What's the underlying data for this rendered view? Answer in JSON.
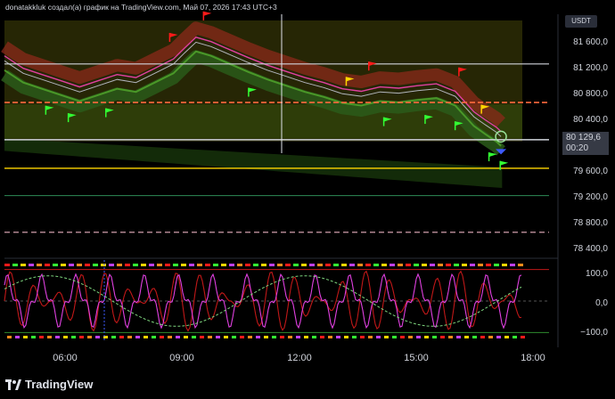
{
  "header": {
    "title": "donatakkluk создал(а) график на TradingView.com, Май 07, 2026 17:43 UTC+3"
  },
  "price_axis": {
    "currency": "USDT",
    "labels": [
      "81 600,0",
      "81 200,0",
      "80 800,0",
      "80 400,0",
      "79 600,0",
      "79 200,0",
      "78 800,0",
      "78 400,0"
    ],
    "last_price": "80 129,6",
    "countdown": "00:20"
  },
  "osc_axis": {
    "labels": [
      "100,0",
      "0,0",
      "−100,0"
    ]
  },
  "time_axis": {
    "labels": [
      "06:00",
      "09:00",
      "12:00",
      "15:00",
      "18:00"
    ]
  },
  "footer": {
    "brand": "TradingView"
  },
  "colors": {
    "background": "#000000",
    "price_line": "#b2b5be",
    "ma_pink": "#e040a0",
    "band_red": "#8b2a1a",
    "band_green": "#2a5a1a",
    "sell_flag": "#ff1a1a",
    "buy_flag": "#33ff33",
    "alt_flag": "#ffd600",
    "osc_red": "#c01818",
    "osc_magenta": "#e040e0",
    "osc_green_dash": "#7ed67e"
  },
  "chart_data": {
    "type": "line",
    "title": "",
    "xlabel": "",
    "ylabel": "",
    "ylim": [
      78200,
      82100
    ],
    "x_axis_labels": [
      "06:00",
      "09:00",
      "12:00",
      "15:00",
      "18:00"
    ],
    "x_range": [
      4.5,
      19.0
    ],
    "series": [
      {
        "values": [
          [
            4.5,
            81350
          ],
          [
            5.0,
            81150
          ],
          [
            5.5,
            81050
          ],
          [
            6.0,
            80950
          ],
          [
            6.5,
            80850
          ],
          [
            7.0,
            80950
          ],
          [
            7.5,
            81050
          ],
          [
            8.0,
            81000
          ],
          [
            8.5,
            81150
          ],
          [
            9.0,
            81300
          ],
          [
            9.3,
            81480
          ],
          [
            9.6,
            81650
          ],
          [
            10.0,
            81580
          ],
          [
            10.5,
            81450
          ],
          [
            11.0,
            81320
          ],
          [
            11.5,
            81200
          ],
          [
            12.0,
            81100
          ],
          [
            12.5,
            81000
          ],
          [
            13.0,
            80920
          ],
          [
            13.5,
            80820
          ],
          [
            14.0,
            80780
          ],
          [
            14.5,
            80850
          ],
          [
            15.0,
            80830
          ],
          [
            15.5,
            80870
          ],
          [
            16.0,
            80900
          ],
          [
            16.5,
            80780
          ],
          [
            17.0,
            80450
          ],
          [
            17.3,
            80320
          ],
          [
            17.6,
            80200
          ],
          [
            17.72,
            80130
          ]
        ]
      }
    ],
    "levels": [
      81300,
      80680,
      80080,
      79620,
      79180,
      78590
    ],
    "signals": {
      "sell": [
        8.9,
        9.8,
        14.2,
        16.6
      ],
      "buy": [
        5.6,
        6.2,
        7.2,
        11.0,
        14.6,
        15.7,
        16.5,
        17.4,
        17.7
      ],
      "yellow": [
        13.6,
        17.2
      ]
    },
    "oscillator": {
      "ylim": [
        -130,
        130
      ],
      "levels": [
        100,
        0,
        -100
      ]
    }
  }
}
